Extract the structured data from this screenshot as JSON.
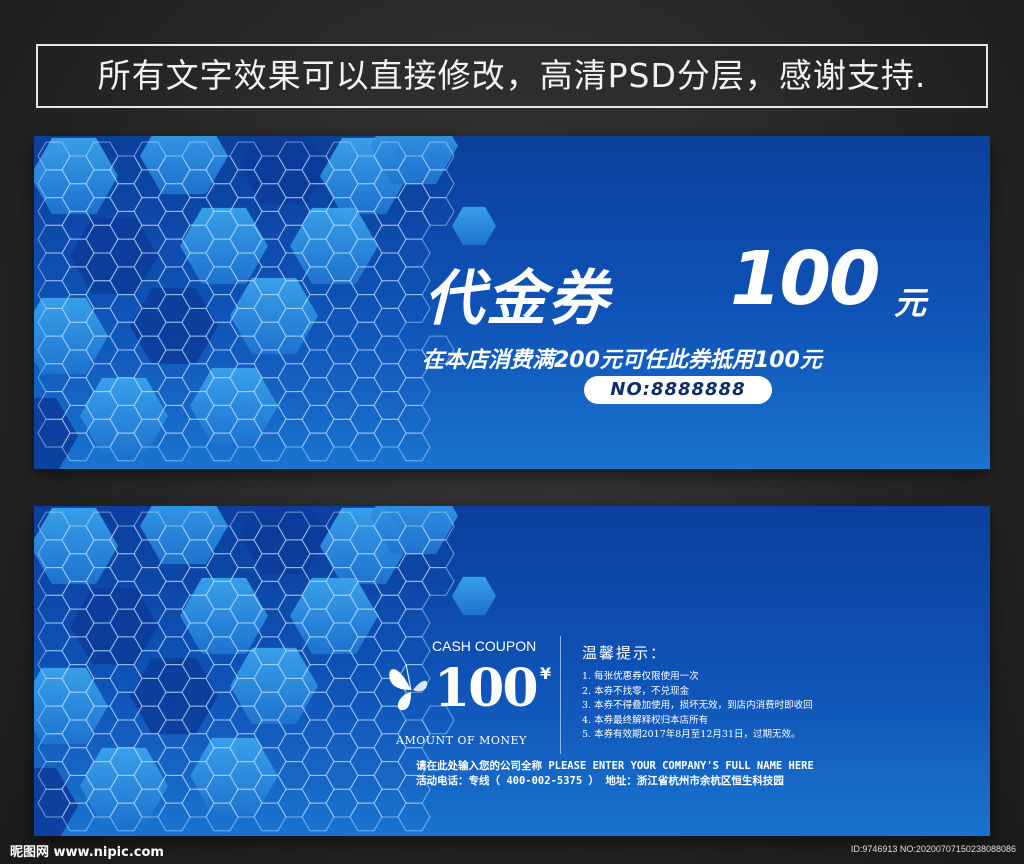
{
  "banner": {
    "text": "所有文字效果可以直接修改，高清PSD分层，感谢支持."
  },
  "front": {
    "title_cn": "代金券",
    "title_amount": "100",
    "title_unit": "元",
    "subtitle": "在本店消费满200元可任此券抵用100元",
    "serial": "NO:8888888"
  },
  "back": {
    "coupon_label": "CASH COUPON",
    "amount_big": "100",
    "currency": "¥",
    "amount_label": "AMOUNT OF MONEY",
    "tips_title": "温馨提示：",
    "tips": [
      "1. 每张优惠券仅限使用一次",
      "2. 本券不找零，不兑现金",
      "3. 本券不得叠加使用，损坏无效，到店内消费时即收回",
      "4. 本券最终解释权归本店所有",
      "5. 本券有效期2017年8月至12月31日，过期无效。"
    ],
    "company_line": "请在此处输入您的公司全称  PLEASE ENTER YOUR COMPANY'S FULL NAME HERE",
    "contact_line": "活动电话：专线（ 400-002-5375 ）  地址：浙江省杭州市余杭区恒生科技园"
  },
  "watermark": {
    "left": "昵图网 www.nipic.com",
    "right": "ID:9746913 NO:20200707150238088086"
  },
  "colors": {
    "card_top": "#0b3f9c",
    "card_bottom": "#1a73cf",
    "hex_light": "#3aa4ec",
    "hex_dark": "#0c3c9a"
  }
}
